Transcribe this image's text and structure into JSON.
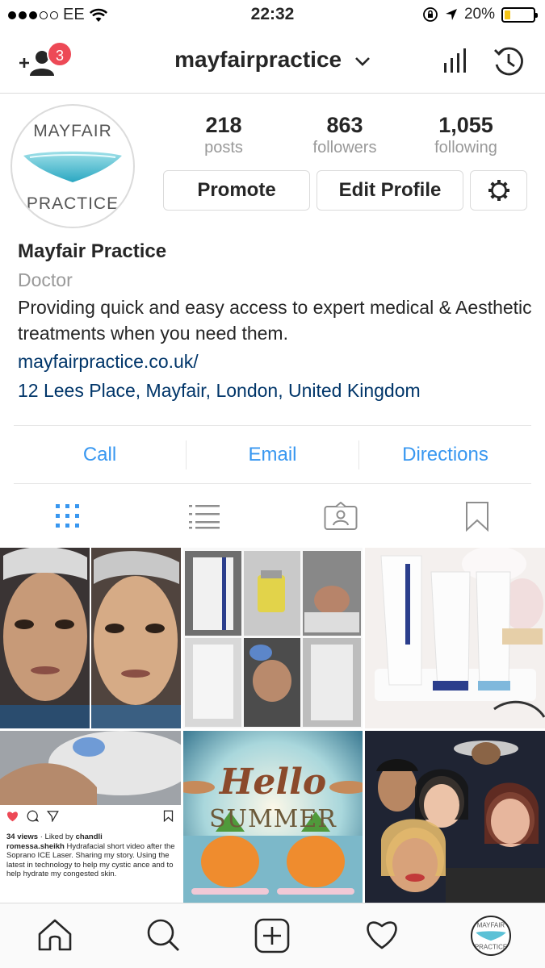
{
  "status_bar": {
    "carrier": "EE",
    "time": "22:32",
    "battery": "20%",
    "battery_level": 0.2,
    "icons": [
      "wifi-icon",
      "orientation-lock-icon",
      "location-icon",
      "battery-icon"
    ]
  },
  "nav": {
    "username": "mayfairpractice",
    "add_user_badge": "3",
    "icons": [
      "add-user-icon",
      "chevron-down-icon",
      "insights-icon",
      "history-icon"
    ]
  },
  "avatar": {
    "logo_top": "MAYFAIR",
    "logo_bottom": "PRACTICE"
  },
  "stats": [
    {
      "value": "218",
      "label": "posts"
    },
    {
      "value": "863",
      "label": "followers"
    },
    {
      "value": "1,055",
      "label": "following"
    }
  ],
  "buttons": {
    "promote": "Promote",
    "edit_profile": "Edit Profile",
    "settings_icon": "gear-icon"
  },
  "bio": {
    "name": "Mayfair Practice",
    "category": "Doctor",
    "description": "Providing quick and easy access to expert medical & Aesthetic treatments when you need them.",
    "website": "mayfairpractice.co.uk/",
    "address": "12 Lees Place, Mayfair, London, United Kingdom"
  },
  "contact": {
    "call": "Call",
    "email": "Email",
    "directions": "Directions"
  },
  "tabs": [
    "grid-view-icon",
    "list-view-icon",
    "tagged-icon",
    "saved-icon"
  ],
  "colors": {
    "link_blue": "#3897f0",
    "address_navy": "#003569",
    "badge_red": "#ed4956",
    "muted_grey": "#999999"
  },
  "grid_post": {
    "views": "34 views",
    "liked_by_prefix": " · Liked by ",
    "liked_by": "chandli",
    "author": "romessa.sheikh",
    "caption": " Hydrafacial short video after the Soprano ICE Laser. Sharing my story. Using the latest in technology to help my cystic ance and to help hydrate my congested skin."
  },
  "summer_tile": {
    "line1": "Hello",
    "line2": "SUMMER"
  },
  "bottom_tabs": [
    "home-icon",
    "search-icon",
    "new-post-icon",
    "activity-heart-icon",
    "profile-avatar"
  ]
}
